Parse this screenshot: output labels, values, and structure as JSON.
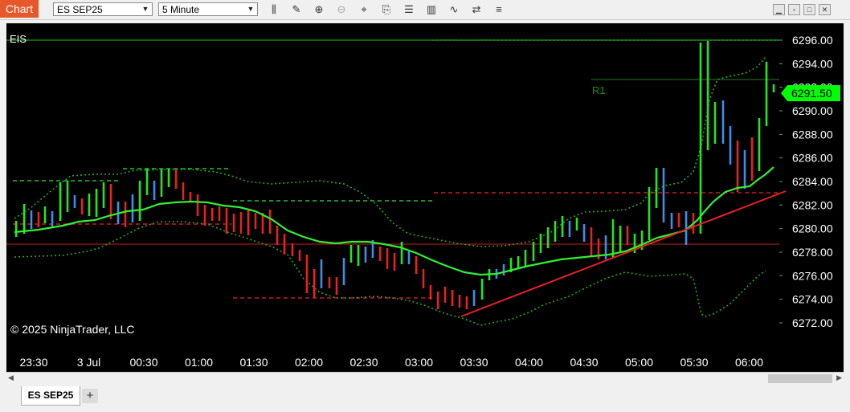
{
  "window": {
    "title_tag": "Chart"
  },
  "toolbar": {
    "instrument": "ES SEP25",
    "interval": "5 Minute",
    "tools": [
      "bar-type-icon",
      "draw-pencil-icon",
      "zoom-in-icon",
      "zoom-out-icon",
      "crosshair-icon",
      "data-box-icon",
      "properties-icon",
      "indicators-icon",
      "strategies-icon",
      "chart-trader-icon",
      "more-options-icon"
    ]
  },
  "chart": {
    "instrument_label": "EIS",
    "copyright": "© 2025 NinjaTrader, LLC",
    "r1_label": "R1",
    "current_price": "6291.50",
    "price_ticks": [
      "6296.00",
      "6294.00",
      "6292.00",
      "6290.00",
      "6288.00",
      "6286.00",
      "6284.00",
      "6282.00",
      "6280.00",
      "6278.00",
      "6276.00",
      "6274.00",
      "6272.00"
    ],
    "time_labels": [
      "23:30",
      "3 Jul",
      "00:30",
      "01:00",
      "01:30",
      "02:00",
      "02:30",
      "03:00",
      "03:30",
      "04:00",
      "04:30",
      "05:00",
      "05:30",
      "06:00"
    ],
    "colors": {
      "up": "#22e622",
      "down": "#e62222",
      "neutral": "#3b8fe8",
      "ma": "#22e622",
      "price_tag": "#00ff00"
    }
  },
  "tabs": {
    "active": "ES SEP25",
    "add_label": "+"
  }
}
